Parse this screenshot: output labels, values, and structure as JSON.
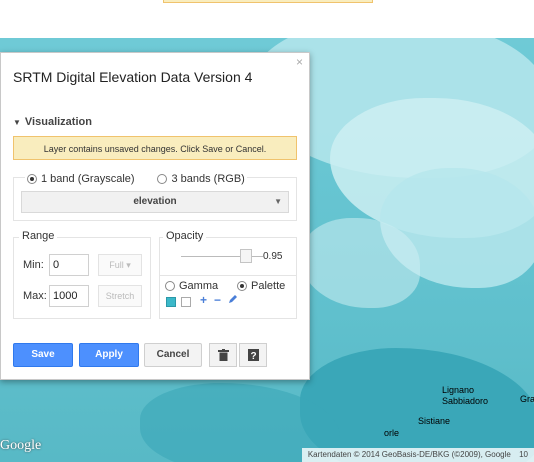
{
  "map": {
    "attribution": "Kartendaten © 2014 GeoBasis-DE/BKG (©2009), Google",
    "attribution_extra": "10",
    "google_logo": "Google",
    "cities": [
      "Lignano",
      "Sabbiadoro",
      "Gra",
      "Sistiane",
      "orle"
    ],
    "colors": {
      "sea": "#5fc0cc",
      "land": "#cdeef2"
    }
  },
  "dialog": {
    "title": "SRTM Digital Elevation Data Version 4",
    "close": "×",
    "section": "Visualization",
    "warning": "Layer contains unsaved changes. Click Save or Cancel.",
    "bands": {
      "option1": "1 band (Grayscale)",
      "option2": "3 bands (RGB)",
      "selected": "option1"
    },
    "band_select": "elevation",
    "range": {
      "legend": "Range",
      "min_label": "Min:",
      "min_value": "0",
      "max_label": "Max:",
      "max_value": "1000",
      "full_label": "Full",
      "stretch_label": "Stretch"
    },
    "opacity": {
      "legend": "Opacity",
      "value": "0.95",
      "level": 0.95
    },
    "palette": {
      "gamma_label": "Gamma",
      "palette_label": "Palette",
      "selected": "palette",
      "swatches": [
        "#3bb8c9",
        "#ffffff"
      ],
      "add": "+",
      "remove": "−"
    },
    "buttons": {
      "save": "Save",
      "apply": "Apply",
      "cancel": "Cancel"
    },
    "colors": {
      "primary": "#4d90fe",
      "warning_bg": "#f9edbe",
      "warning_border": "#f0c36d"
    }
  }
}
